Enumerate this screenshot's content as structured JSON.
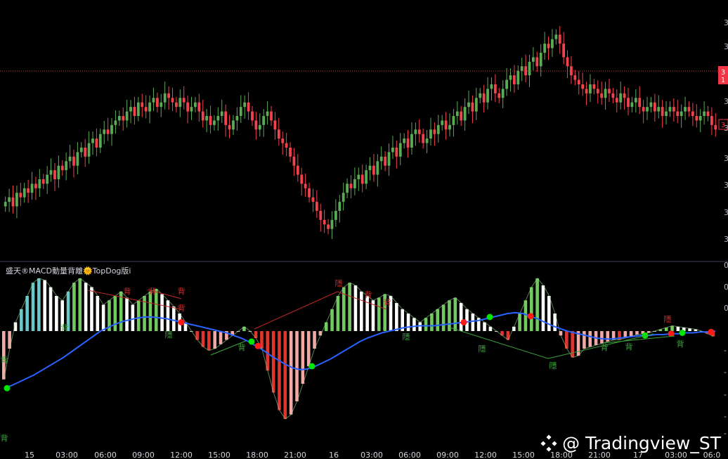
{
  "indicator": {
    "title": "盛天®MACD動量背離🌞TopDog版i"
  },
  "watermark": {
    "text": "@ Tradingview_ST"
  },
  "price_axis": {
    "tick_labels": [
      "3",
      "3",
      "3",
      "3",
      "3",
      "3",
      "3",
      "3",
      "3"
    ],
    "last_price_label_top": "3",
    "last_price_label_bottom": "1",
    "alert_label": "3"
  },
  "indicator_axis": {
    "tick_labels": [
      "0",
      "0",
      "0",
      "-",
      "-",
      "-",
      "-",
      "-"
    ]
  },
  "time_axis": {
    "labels": [
      "15",
      "03:00",
      "06:00",
      "09:00",
      "12:00",
      "15:00",
      "18:00",
      "21:00",
      "16",
      "03:00",
      "06:00",
      "09:00",
      "12:00",
      "15:00",
      "18:00",
      "21:00",
      "17",
      "03:00",
      "06:0"
    ]
  },
  "signals": {
    "bei": "背",
    "yin": "隱"
  },
  "colors": {
    "background": "#000000",
    "bull_candle": "#5aab55",
    "bear_candle": "#f2434d",
    "histogram_positive": "#72c95f",
    "histogram_negative": "#e0342f",
    "histogram_cyan": "#69c8c8",
    "histogram_white": "#ffffff",
    "signal_line": "#2962ff",
    "dot_green": "#00e600",
    "dot_red": "#ff1a1a",
    "price_line": "#e03a3a"
  },
  "chart_data": {
    "type": "candlestick+macd",
    "price_series_close": [
      100,
      101,
      99,
      102,
      101,
      103,
      102,
      104,
      103,
      105,
      104,
      106,
      107,
      105,
      108,
      107,
      109,
      110,
      108,
      111,
      112,
      110,
      113,
      114,
      112,
      115,
      116,
      115,
      117,
      118,
      119,
      118,
      120,
      121,
      119,
      122,
      121,
      120,
      122,
      123,
      121,
      122,
      124,
      123,
      122,
      121,
      123,
      122,
      120,
      121,
      122,
      120,
      118,
      119,
      117,
      118,
      119,
      120,
      117,
      116,
      118,
      119,
      121,
      122,
      120,
      118,
      116,
      117,
      119,
      120,
      118,
      116,
      114,
      113,
      112,
      110,
      108,
      106,
      104,
      103,
      101,
      100,
      98,
      96,
      95,
      94,
      96,
      98,
      100,
      102,
      104,
      103,
      105,
      106,
      104,
      107,
      108,
      106,
      109,
      110,
      108,
      111,
      112,
      110,
      113,
      114,
      112,
      115,
      116,
      115,
      113,
      114,
      116,
      115,
      117,
      118,
      116,
      117,
      119,
      120,
      118,
      121,
      122,
      120,
      123,
      124,
      122,
      125,
      126,
      124,
      123,
      125,
      127,
      128,
      126,
      129,
      130,
      128,
      131,
      132,
      130,
      133,
      135,
      134,
      136,
      137,
      135,
      132,
      130,
      128,
      127,
      126,
      125,
      124,
      126,
      125,
      124,
      123,
      125,
      124,
      123,
      122,
      124,
      123,
      121,
      122,
      123,
      121,
      120,
      121,
      122,
      120,
      121,
      119,
      120,
      121,
      120,
      119,
      120,
      121,
      120,
      119,
      118,
      119,
      120,
      119,
      117,
      116
    ],
    "macd_histogram": [
      -55,
      -20,
      10,
      25,
      40,
      55,
      60,
      58,
      50,
      40,
      35,
      45,
      55,
      60,
      55,
      50,
      40,
      30,
      35,
      40,
      45,
      38,
      30,
      35,
      40,
      45,
      48,
      42,
      35,
      28,
      20,
      10,
      0,
      -10,
      -18,
      -22,
      -20,
      -15,
      -10,
      -5,
      0,
      5,
      0,
      -8,
      -20,
      -45,
      -70,
      -90,
      -100,
      -95,
      -80,
      -60,
      -40,
      -20,
      -5,
      10,
      25,
      40,
      50,
      55,
      52,
      45,
      40,
      35,
      38,
      42,
      40,
      32,
      25,
      20,
      15,
      10,
      15,
      20,
      25,
      30,
      35,
      38,
      32,
      25,
      20,
      15,
      10,
      5,
      0,
      -5,
      -10,
      5,
      20,
      35,
      50,
      60,
      52,
      40,
      20,
      -5,
      -20,
      -30,
      -28,
      -20,
      -18,
      -16,
      -14,
      -12,
      -10,
      -10,
      -8,
      -6,
      -4,
      -3,
      -2,
      0,
      2,
      4,
      6,
      5,
      4,
      3,
      2,
      0,
      -3,
      -6
    ],
    "signal_line": [
      -65,
      -62,
      -58,
      -54,
      -50,
      -45,
      -40,
      -35,
      -30,
      -24,
      -18,
      -12,
      -6,
      0,
      4,
      8,
      11,
      13,
      15,
      16,
      16,
      15,
      14,
      12,
      10,
      8,
      6,
      4,
      2,
      0,
      -2,
      -5,
      -8,
      -12,
      -17,
      -22,
      -28,
      -33,
      -38,
      -42,
      -44,
      -43,
      -40,
      -36,
      -32,
      -27,
      -22,
      -17,
      -12,
      -8,
      -5,
      -2,
      0,
      2,
      4,
      5,
      6,
      6,
      6,
      7,
      8,
      9,
      10,
      11,
      12,
      14,
      16,
      18,
      20,
      21,
      20,
      17,
      14,
      10,
      6,
      3,
      0,
      -2,
      -4,
      -6,
      -8,
      -9,
      -9,
      -8,
      -7,
      -6,
      -5,
      -5,
      -4,
      -4,
      -3,
      -3,
      -2,
      -2,
      -1,
      -1,
      0
    ]
  }
}
